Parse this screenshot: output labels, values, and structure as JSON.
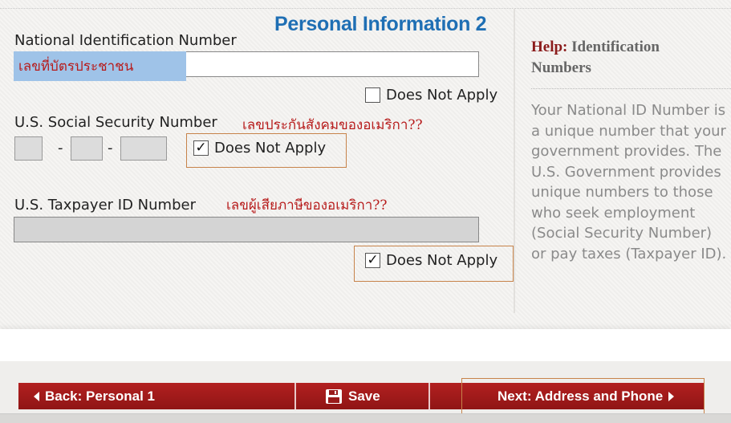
{
  "page_title": "Personal Information 2",
  "national_id": {
    "label": "National Identification Number",
    "annotation": "เลขที่บัตรประชาชน",
    "value": "",
    "does_not_apply": {
      "label": "Does Not Apply",
      "checked": false
    }
  },
  "ssn": {
    "label": "U.S. Social Security Number",
    "annotation": "เลขประกันสังคมของอเมริกา??",
    "separator": "-",
    "parts": [
      "",
      "",
      ""
    ],
    "does_not_apply": {
      "label": "Does Not Apply",
      "checked": true
    }
  },
  "taxpayer": {
    "label": "U.S. Taxpayer ID Number",
    "annotation": "เลขผู้เสียภาษีของอเมริกา??",
    "value": "",
    "does_not_apply": {
      "label": "Does Not Apply",
      "checked": true
    }
  },
  "help": {
    "prefix": "Help:",
    "title": "Identification Numbers",
    "text": "Your National ID Number is a unique number that your government provides. The U.S. Government provides unique numbers to those who seek employment (Social Security Number) or pay taxes (Taxpayer ID)."
  },
  "nav": {
    "back_label": "Back: Personal 1",
    "save_label": "Save",
    "next_label": "Next: Address and Phone"
  },
  "colors": {
    "accent": "#1f6fb4",
    "nav_red": "#a11a1a",
    "annotation": "#b71c1c",
    "highlight": "#9fc3e8",
    "frame": "#c7834a"
  }
}
